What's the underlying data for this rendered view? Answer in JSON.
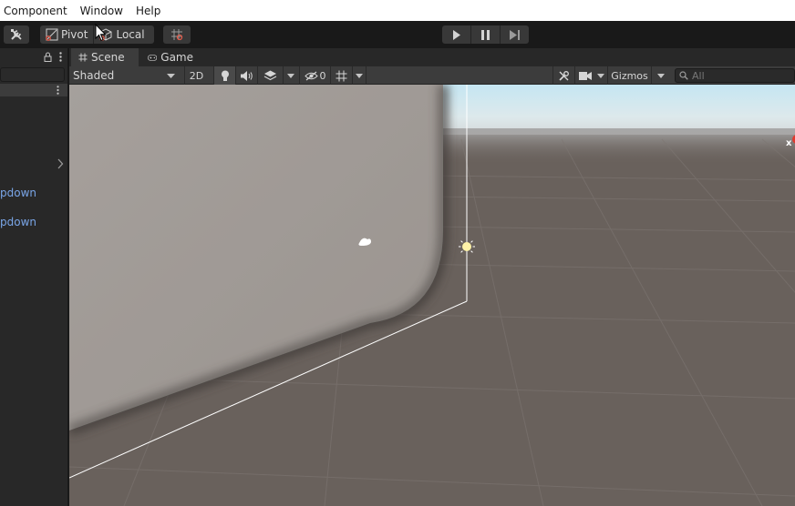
{
  "menubar": {
    "items": [
      "Component",
      "Window",
      "Help"
    ]
  },
  "toolbar": {
    "pivot_label": "Pivot",
    "local_label": "Local",
    "icons": [
      "tools-icon",
      "pivot-icon",
      "local-icon",
      "grid-snap-icon",
      "play-icon",
      "pause-icon",
      "step-icon"
    ]
  },
  "left_panel": {
    "items": [
      "pdown",
      "pdown"
    ]
  },
  "scene": {
    "tabs": [
      {
        "label": "Scene",
        "icon": "hash-icon"
      },
      {
        "label": "Game",
        "icon": "gamepad-icon"
      }
    ],
    "shading_mode": "Shaded",
    "mode_2d": "2D",
    "hidden_count": "0",
    "gizmos_label": "Gizmos",
    "search_placeholder": "All",
    "axis_label": "x"
  },
  "colors": {
    "menubar_bg": "#ffffff",
    "toolbar_bg": "#191919",
    "panel_bg": "#282828",
    "ground": "#69615c",
    "sky_top": "#c9e6f0",
    "link": "#7aa6e8"
  }
}
